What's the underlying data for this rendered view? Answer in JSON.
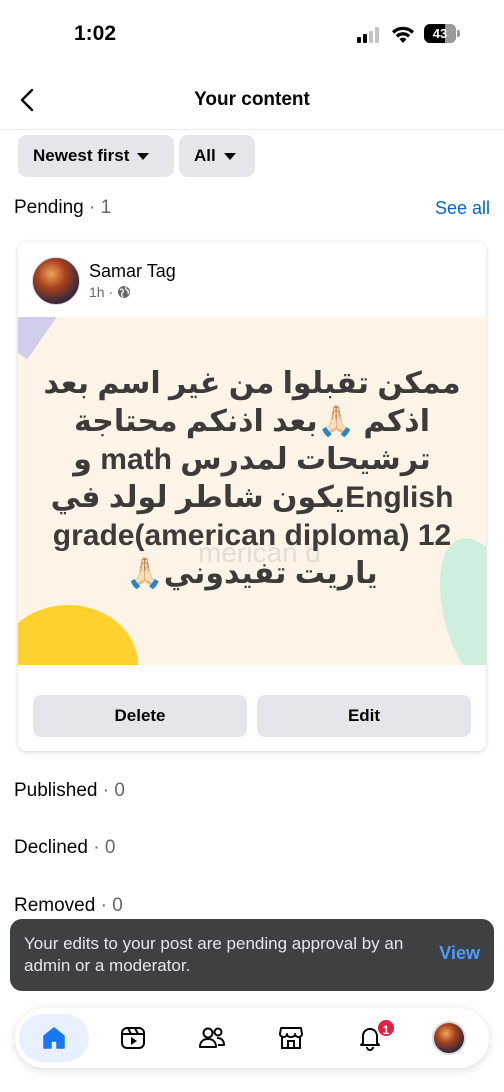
{
  "status_bar": {
    "time": "1:02",
    "battery": "43"
  },
  "header": {
    "title": "Your content"
  },
  "filters": {
    "sort": "Newest first",
    "type": "All"
  },
  "sections": {
    "pending": {
      "label": "Pending",
      "sep": " · ",
      "count": "1",
      "see_all": "See all"
    },
    "published": {
      "label": "Published",
      "sep": " · ",
      "count": "0"
    },
    "declined": {
      "label": "Declined",
      "sep": " · ",
      "count": "0"
    },
    "removed": {
      "label": "Removed",
      "sep": " · ",
      "count": "0"
    }
  },
  "post": {
    "author": "Samar Tag",
    "time": "1h",
    "dot": "·",
    "text": "ممكن تقبلوا من غير اسم بعد اذكم 🙏🏻بعد اذنكم محتاجة ترشيحات لمدرس math و Englishيكون شاطر لولد في grade(american diploma) 12 ياريت  تفيدوني🙏🏻",
    "watermark": "merican d",
    "delete_label": "Delete",
    "edit_label": "Edit"
  },
  "toast": {
    "message": "Your edits to your post are pending approval by an admin or a moderator.",
    "action": "View"
  },
  "nav": {
    "items": [
      {
        "icon": "home-icon",
        "active": true
      },
      {
        "icon": "video-icon",
        "active": false
      },
      {
        "icon": "friends-icon",
        "active": false
      },
      {
        "icon": "marketplace-icon",
        "active": false
      },
      {
        "icon": "bell-icon",
        "active": false,
        "badge": "1"
      },
      {
        "icon": "profile-avatar",
        "active": false
      }
    ]
  },
  "colors": {
    "accent": "#0064d1",
    "toast_action": "#4d9bff",
    "badge": "#e41e3f",
    "active_nav": "#1877f2"
  }
}
